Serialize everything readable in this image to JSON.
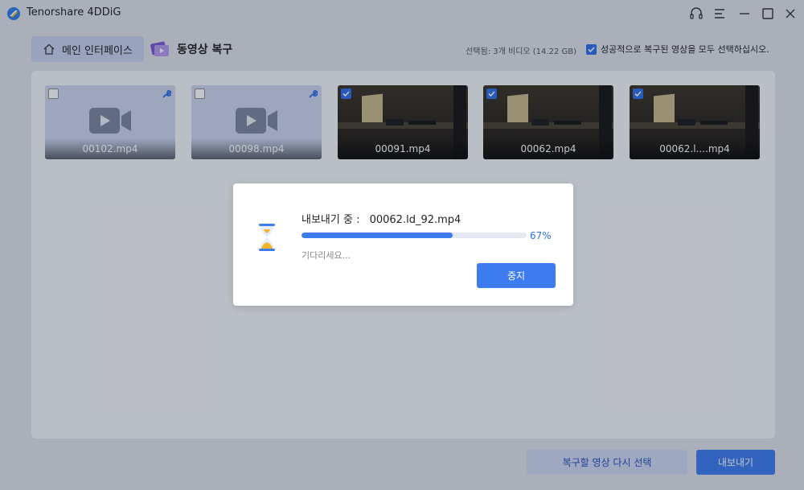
{
  "app": {
    "title": "Tenorshare 4DDiG"
  },
  "nav": {
    "home_label": "메인 인터페이스",
    "current_label": "동영상 복구"
  },
  "selection": {
    "info": "선택됨: 3개 비디오 (14.22 GB)",
    "select_all_label": "성공적으로 복구된 영상을 모두 선택하십시오.",
    "select_all_checked": true
  },
  "videos": [
    {
      "name": "00102.mp4",
      "checked": false,
      "has_preview": false
    },
    {
      "name": "00098.mp4",
      "checked": false,
      "has_preview": false
    },
    {
      "name": "00091.mp4",
      "checked": true,
      "has_preview": true
    },
    {
      "name": "00062.mp4",
      "checked": true,
      "has_preview": true
    },
    {
      "name": "00062.l....mp4",
      "checked": true,
      "has_preview": true
    }
  ],
  "footer": {
    "reselect_label": "복구할 영상 다시 선택",
    "export_label": "내보내기"
  },
  "dialog": {
    "status_prefix": "내보내기 중 :",
    "file_name": "00062.ld_92.mp4",
    "progress_percent": 67,
    "progress_text": "67%",
    "wait_text": "기다리세요...",
    "stop_label": "중지"
  },
  "colors": {
    "accent": "#3d7cf0",
    "checkbox": "#2f6fe8",
    "thumb_placeholder": "#cdd6ee",
    "breadcrumb_active": "#c9d2ee"
  }
}
